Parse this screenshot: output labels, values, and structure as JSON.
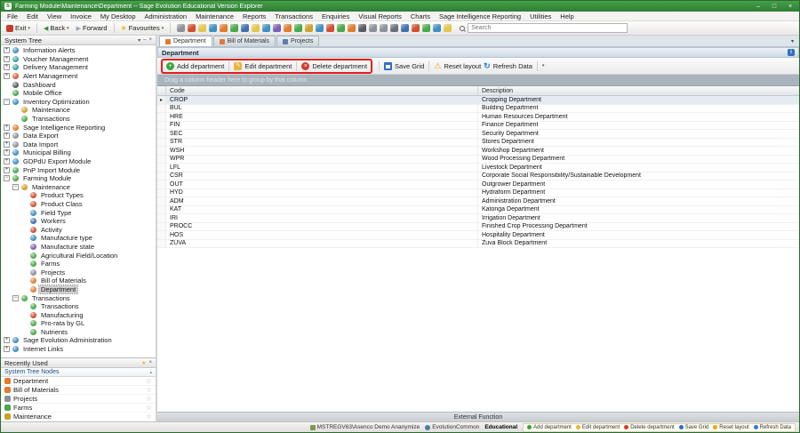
{
  "window": {
    "title": "Farming Module\\Maintenance\\Department -- Sage Evolution Educational Version Explorer",
    "controls": {
      "minimize": "–",
      "maximize": "□",
      "close": "×"
    }
  },
  "menu": {
    "items": [
      "File",
      "Edit",
      "View",
      "Invoice",
      "My Desktop",
      "Administration",
      "Maintenance",
      "Reports",
      "Transactions",
      "Enquiries",
      "Visual Reports",
      "Charts",
      "Sage Intelligence Reporting",
      "Utilities",
      "Help"
    ]
  },
  "toolbar": {
    "exit_label": "Exit",
    "back_label": "Back",
    "forward_label": "Forward",
    "favourites_label": "Favourites",
    "search_placeholder": "Search",
    "icons": [
      {
        "name": "calculator",
        "color": "#8a9199"
      },
      {
        "name": "calendar",
        "color": "#d04e2f"
      },
      {
        "name": "notes",
        "color": "#e5c54b"
      },
      {
        "name": "contacts",
        "color": "#3f8fc0"
      },
      {
        "name": "mail",
        "color": "#e07b2f"
      },
      {
        "name": "reports",
        "color": "#4aa84a"
      },
      {
        "name": "chart",
        "color": "#3f6fae"
      },
      {
        "name": "currency",
        "color": "#e5c54b"
      },
      {
        "name": "bank",
        "color": "#3f8fc0"
      },
      {
        "name": "ledger",
        "color": "#7a5fb5"
      },
      {
        "name": "customers",
        "color": "#e07b2f"
      },
      {
        "name": "suppliers",
        "color": "#4aa84a"
      },
      {
        "name": "inventory",
        "color": "#c9a227"
      },
      {
        "name": "invoice",
        "color": "#3f8fc0"
      },
      {
        "name": "orders",
        "color": "#d04e2f"
      },
      {
        "name": "jobs",
        "color": "#4aa84a"
      },
      {
        "name": "alerts",
        "color": "#e07b2f"
      },
      {
        "name": "dashboard",
        "color": "#555c63"
      },
      {
        "name": "import",
        "color": "#8a9199"
      },
      {
        "name": "export",
        "color": "#8a9199"
      },
      {
        "name": "settings",
        "color": "#6a7077"
      },
      {
        "name": "users",
        "color": "#3f6fae"
      },
      {
        "name": "security",
        "color": "#d04e2f"
      },
      {
        "name": "backup",
        "color": "#4aa84a"
      },
      {
        "name": "help",
        "color": "#3f8fc0"
      },
      {
        "name": "info",
        "color": "#e5c54b"
      }
    ]
  },
  "system_tree": {
    "title": "System Tree",
    "items": [
      {
        "label": "Information Alerts",
        "level": 0,
        "expand": "plus",
        "color": "#3f8fc0"
      },
      {
        "label": "Voucher Management",
        "level": 0,
        "expand": "plus",
        "color": "#3fa0a0"
      },
      {
        "label": "Delivery Management",
        "level": 0,
        "expand": "plus",
        "color": "#3fa0a0"
      },
      {
        "label": "Alert Management",
        "level": 0,
        "expand": "plus",
        "color": "#d06030"
      },
      {
        "label": "Dashboard",
        "level": 0,
        "expand": null,
        "color": "#555c63"
      },
      {
        "label": "Mobile Office",
        "level": 0,
        "expand": null,
        "color": "#4aa84a"
      },
      {
        "label": "Inventory Optimization",
        "level": 0,
        "expand": "minus",
        "color": "#3f8fc0"
      },
      {
        "label": "Maintenance",
        "level": 1,
        "expand": null,
        "color": "#c9a227"
      },
      {
        "label": "Transactions",
        "level": 1,
        "expand": null,
        "color": "#4aa84a"
      },
      {
        "label": "Sage Intelligence Reporting",
        "level": 0,
        "expand": "plus",
        "color": "#e07b2f"
      },
      {
        "label": "Data Export",
        "level": 0,
        "expand": "plus",
        "color": "#8a9199"
      },
      {
        "label": "Data Import",
        "level": 0,
        "expand": "plus",
        "color": "#8a9199"
      },
      {
        "label": "Municipal Billing",
        "level": 0,
        "expand": "plus",
        "color": "#3f8fc0"
      },
      {
        "label": "GDPdU Export Module",
        "level": 0,
        "expand": "plus",
        "color": "#3f8fc0"
      },
      {
        "label": "PnP Import Module",
        "level": 0,
        "expand": "plus",
        "color": "#4aa84a"
      },
      {
        "label": "Farming Module",
        "level": 0,
        "expand": "minus",
        "color": "#4aa84a"
      },
      {
        "label": "Maintenance",
        "level": 1,
        "expand": "minus",
        "color": "#c9a227"
      },
      {
        "label": "Product Types",
        "level": 2,
        "expand": null,
        "color": "#d04e2f"
      },
      {
        "label": "Product Class",
        "level": 2,
        "expand": null,
        "color": "#d04e2f"
      },
      {
        "label": "Field Type",
        "level": 2,
        "expand": null,
        "color": "#3f8fc0"
      },
      {
        "label": "Workers",
        "level": 2,
        "expand": null,
        "color": "#3f6fae"
      },
      {
        "label": "Activity",
        "level": 2,
        "expand": null,
        "color": "#d04e2f"
      },
      {
        "label": "Manufacture type",
        "level": 2,
        "expand": null,
        "color": "#3f8fc0"
      },
      {
        "label": "Manufacture state",
        "level": 2,
        "expand": null,
        "color": "#7a5fb5"
      },
      {
        "label": "Agricultural Field/Location",
        "level": 2,
        "expand": null,
        "color": "#4aa84a"
      },
      {
        "label": "Farms",
        "level": 2,
        "expand": null,
        "color": "#4aa84a"
      },
      {
        "label": "Projects",
        "level": 2,
        "expand": null,
        "color": "#8a9199"
      },
      {
        "label": "Bill of Materials",
        "level": 2,
        "expand": null,
        "color": "#e07b2f"
      },
      {
        "label": "Department",
        "level": 2,
        "expand": null,
        "color": "#e07b2f",
        "selected": true
      },
      {
        "label": "Transactions",
        "level": 1,
        "expand": "minus",
        "color": "#4aa84a"
      },
      {
        "label": "Transactions",
        "level": 2,
        "expand": null,
        "color": "#4aa84a"
      },
      {
        "label": "Manufacturing",
        "level": 2,
        "expand": null,
        "color": "#d04e2f"
      },
      {
        "label": "Pro-rata by GL",
        "level": 2,
        "expand": null,
        "color": "#4aa84a"
      },
      {
        "label": "Nutrients",
        "level": 2,
        "expand": null,
        "color": "#4aa84a"
      },
      {
        "label": "Sage Evolution Administration",
        "level": 0,
        "expand": "plus",
        "color": "#3f8fc0"
      },
      {
        "label": "Internet Links",
        "level": 0,
        "expand": "plus",
        "color": "#3f8fc0"
      }
    ]
  },
  "recently_used": {
    "title": "Recently Used",
    "subheader": "System Tree Nodes",
    "items": [
      {
        "label": "Department",
        "color": "#e07b2f"
      },
      {
        "label": "Bill of Materials",
        "color": "#e07b2f"
      },
      {
        "label": "Projects",
        "color": "#8a9199"
      },
      {
        "label": "Farms",
        "color": "#4aa84a"
      },
      {
        "label": "Maintenance",
        "color": "#c9a227"
      }
    ]
  },
  "main": {
    "tabs": [
      {
        "label": "Department",
        "active": true,
        "color": "#e07b2f"
      },
      {
        "label": "Bill of Materials",
        "active": false,
        "color": "#e07b2f"
      },
      {
        "label": "Projects",
        "active": false,
        "color": "#5a7fae"
      }
    ],
    "panel_title": "Department",
    "toolbar": {
      "add_label": "Add department",
      "edit_label": "Edit department",
      "delete_label": "Delete department",
      "save_label": "Save Grid",
      "reset_label": "Reset layout",
      "refresh_label": "Refresh Data"
    },
    "group_hint": "Drag a column header here to group by that column",
    "grid": {
      "columns": [
        "Code",
        "Description"
      ],
      "selected_code": "CROP",
      "rows": [
        {
          "code": "CROP",
          "description": "Cropping Department"
        },
        {
          "code": "BUL",
          "description": "Building Department"
        },
        {
          "code": "HRE",
          "description": "Human Resources Department"
        },
        {
          "code": "FIN",
          "description": "Finance Department"
        },
        {
          "code": "SEC",
          "description": "Security Department"
        },
        {
          "code": "STR",
          "description": "Stores Department"
        },
        {
          "code": "WSH",
          "description": "Workshop Department"
        },
        {
          "code": "WPR",
          "description": "Wood Processing Department"
        },
        {
          "code": "LFL",
          "description": "Livestock Department"
        },
        {
          "code": "CSR",
          "description": "Corporate Social Responsibility/Sustainable Development"
        },
        {
          "code": "OUT",
          "description": "Outgrower Department"
        },
        {
          "code": "HYD",
          "description": "Hydraform Department"
        },
        {
          "code": "ADM",
          "description": "Administration Department"
        },
        {
          "code": "KAT",
          "description": "Katonga Department"
        },
        {
          "code": "IRI",
          "description": "Irrigation Department"
        },
        {
          "code": "PROCC",
          "description": "Finished Crop Processing Department"
        },
        {
          "code": "HOS",
          "description": "Hospitality Department"
        },
        {
          "code": "ZUVA",
          "description": "Zuva Block Department"
        }
      ]
    }
  },
  "status": {
    "external_function": "External Function",
    "database": "MSTREGV63\\Asenco Demo Ananymize",
    "company": "EvolutionCommon",
    "edition": "Educational",
    "mini_buttons": [
      {
        "label": "Add department",
        "color": "#3ba53b"
      },
      {
        "label": "Edit department",
        "color": "#e8b63a"
      },
      {
        "label": "Delete department",
        "color": "#d23b2f"
      },
      {
        "label": "Save Grid",
        "color": "#2e6fc0"
      },
      {
        "label": "Reset layout",
        "color": "#e6a817"
      },
      {
        "label": "Refresh Data",
        "color": "#2e7bd6"
      }
    ]
  }
}
